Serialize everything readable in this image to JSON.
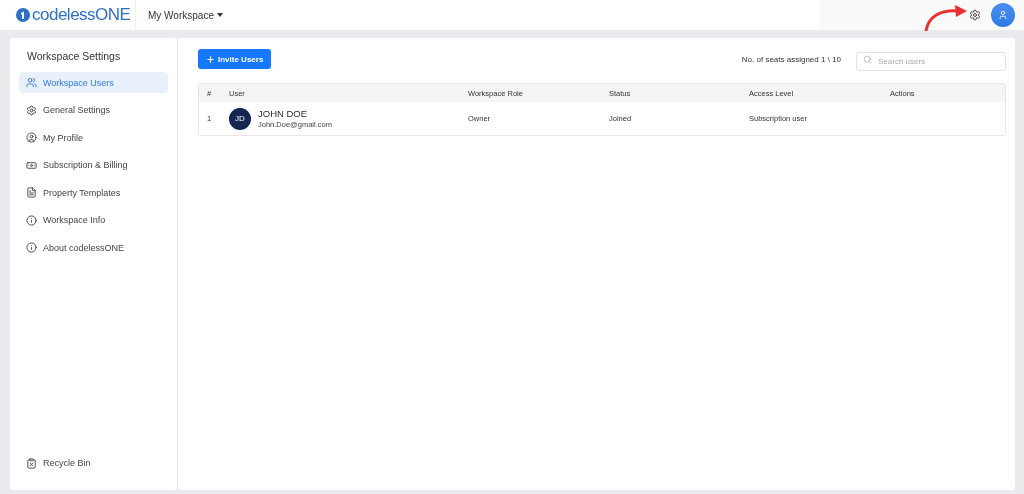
{
  "header": {
    "logo": "codelessONE",
    "workspace_menu": "My Workspace"
  },
  "sidebar": {
    "title": "Workspace Settings",
    "items": [
      {
        "label": "Workspace Users",
        "selected": true
      },
      {
        "label": "General Settings",
        "selected": false
      },
      {
        "label": "My Profile",
        "selected": false
      },
      {
        "label": "Subscription & Billing",
        "selected": false
      },
      {
        "label": "Property Templates",
        "selected": false
      },
      {
        "label": "Workspace Info",
        "selected": false
      },
      {
        "label": "About codelessONE",
        "selected": false
      }
    ],
    "footer_item": {
      "label": "Recycle Bin",
      "selected": false
    }
  },
  "toolbar": {
    "invite_button": "Invite Users",
    "seats": "No. of seats assigned 1 \\ 10",
    "search": {
      "placeholder": "Search users"
    }
  },
  "table": {
    "columns": [
      "#",
      "User",
      "Workspace Role",
      "Status",
      "Access Level",
      "Actions"
    ],
    "rows": [
      {
        "index": "1",
        "avatar": "JD",
        "name": "JOHN DOE",
        "email": "John.Doe@gmail.com",
        "role": "Owner",
        "status": "Joined",
        "access_level": "Subscription user"
      }
    ]
  }
}
